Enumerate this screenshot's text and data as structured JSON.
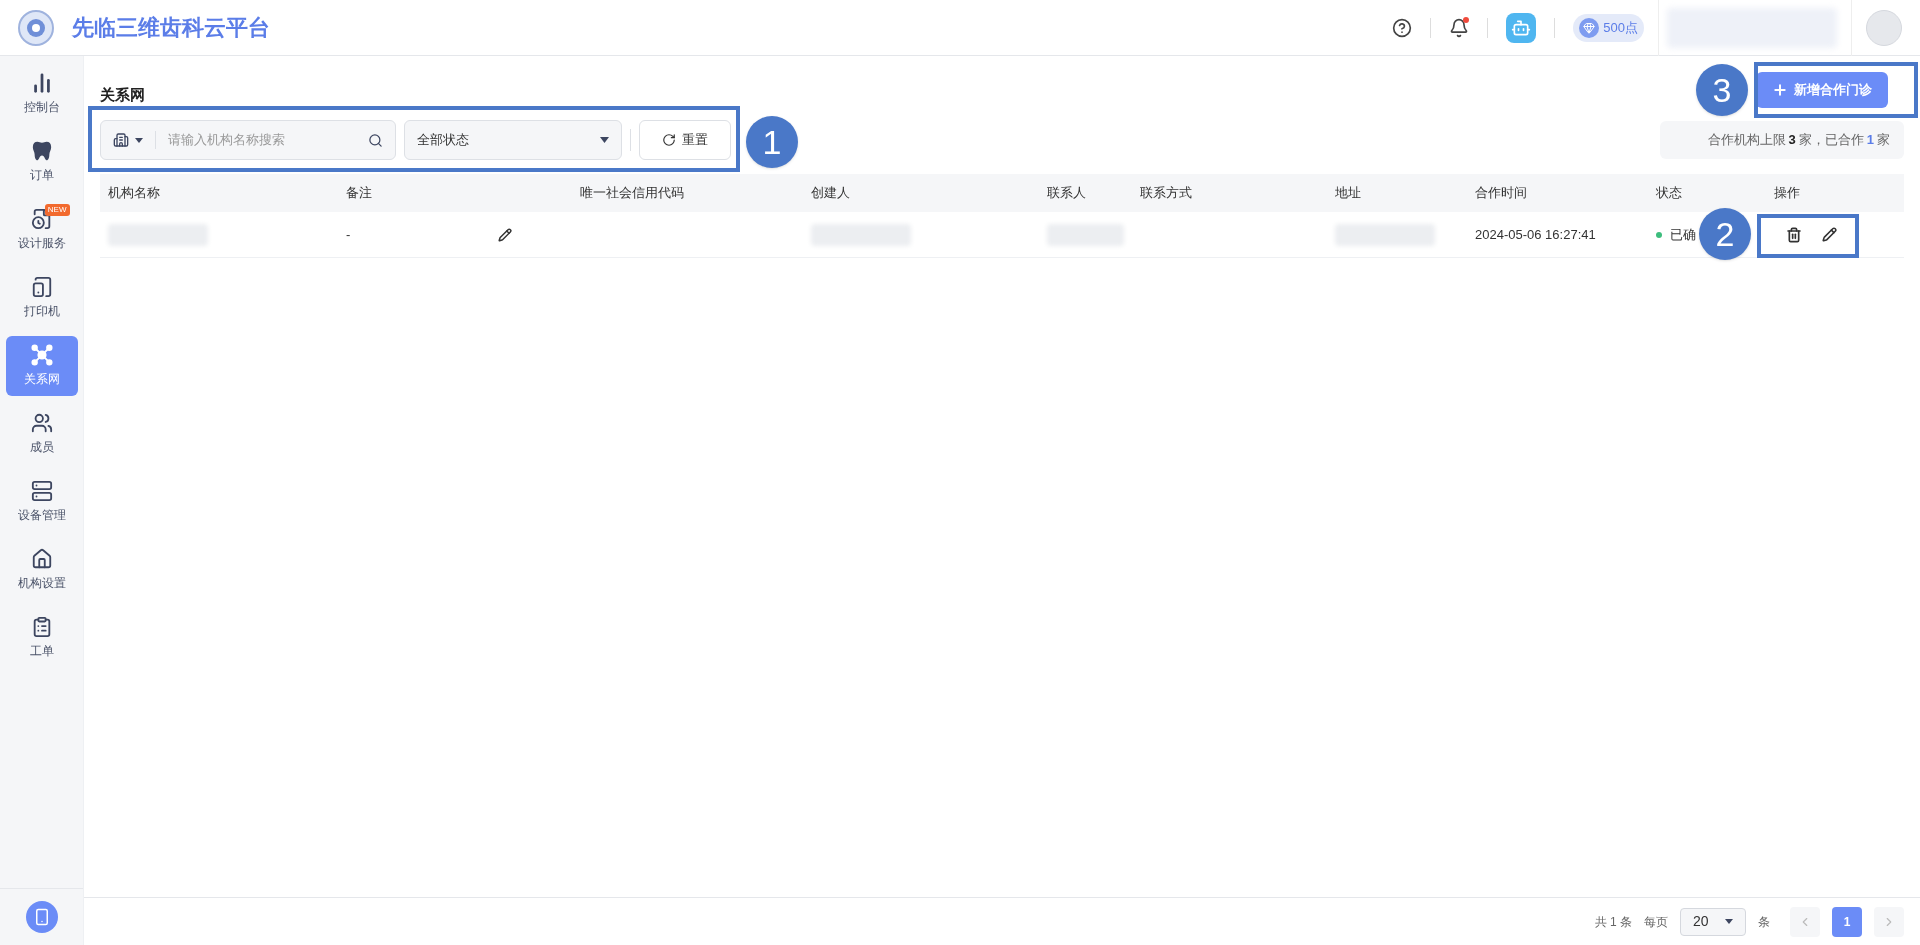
{
  "header": {
    "title": "先临三维齿科云平台",
    "points": "500点",
    "has_unread": true
  },
  "sidebar": {
    "items": [
      {
        "label": "控制台",
        "selected": false
      },
      {
        "label": "订单",
        "selected": false
      },
      {
        "label": "设计服务",
        "selected": false,
        "badge": "NEW"
      },
      {
        "label": "打印机",
        "selected": false
      },
      {
        "label": "关系网",
        "selected": true
      },
      {
        "label": "成员",
        "selected": false
      },
      {
        "label": "设备管理",
        "selected": false
      },
      {
        "label": "机构设置",
        "selected": false
      },
      {
        "label": "工单",
        "selected": false
      }
    ]
  },
  "page": {
    "title": "关系网"
  },
  "toolbar": {
    "search": {
      "placeholder": "请输入机构名称搜索"
    },
    "status_select": {
      "value": "全部状态"
    },
    "reset_button": "重置"
  },
  "add_button": "新增合作门诊",
  "quota": {
    "prefix": "合作机构上限",
    "limit": "3",
    "middle": "家，已合作",
    "count": "1",
    "suffix": "家"
  },
  "table": {
    "columns": [
      "机构名称",
      "备注",
      "唯一社会信用代码",
      "创建人",
      "联系人",
      "联系方式",
      "地址",
      "合作时间",
      "状态",
      "操作"
    ],
    "rows": [
      {
        "cells": [
          {
            "kind": "redacted"
          },
          {
            "kind": "note",
            "text": "-"
          },
          {
            "kind": "empty"
          },
          {
            "kind": "redacted"
          },
          {
            "kind": "redacted"
          },
          {
            "kind": "empty"
          },
          {
            "kind": "redacted"
          },
          {
            "kind": "text",
            "text": "2024-05-06 16:27:41"
          },
          {
            "kind": "status",
            "text": "已确",
            "color": "#3dbd7d"
          },
          {
            "kind": "actions"
          }
        ]
      }
    ]
  },
  "pagination": {
    "total": "共 1 条",
    "per_page_label": "每页",
    "per_page": "20",
    "unit": "条",
    "pages": [
      {
        "label": "1",
        "selected": true
      }
    ]
  },
  "annotations": [
    {
      "label": "1"
    },
    {
      "label": "2"
    },
    {
      "label": "3"
    }
  ]
}
